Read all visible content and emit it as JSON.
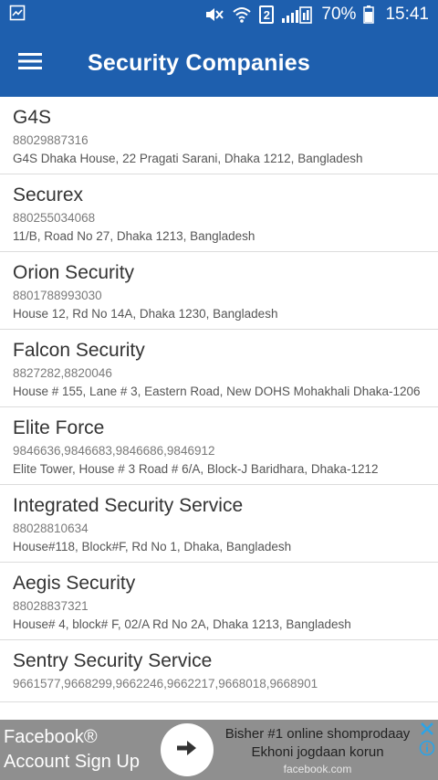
{
  "status_bar": {
    "battery_percent": "70%",
    "time": "15:41",
    "sim_label": "2"
  },
  "app_bar": {
    "title": "Security Companies"
  },
  "companies": [
    {
      "name": "G4S",
      "phone": "88029887316",
      "address": "G4S Dhaka House, 22 Pragati Sarani, Dhaka 1212, Bangladesh"
    },
    {
      "name": "Securex",
      "phone": "880255034068",
      "address": "11/B, Road No 27, Dhaka 1213, Bangladesh"
    },
    {
      "name": "Orion Security",
      "phone": "8801788993030",
      "address": "House 12, Rd No 14A, Dhaka 1230, Bangladesh"
    },
    {
      "name": "Falcon Security",
      "phone": "8827282,8820046",
      "address": "House # 155, Lane # 3, Eastern Road, New DOHS Mohakhali Dhaka-1206"
    },
    {
      "name": "Elite Force",
      "phone": "9846636,9846683,9846686,9846912",
      "address": "Elite Tower, House # 3 Road # 6/A, Block-J Baridhara, Dhaka-1212"
    },
    {
      "name": "Integrated Security Service",
      "phone": "88028810634",
      "address": "House#118, Block#F, Rd No 1, Dhaka, Bangladesh"
    },
    {
      "name": "Aegis Security",
      "phone": "88028837321",
      "address": "House# 4, block# F, 02/A Rd No 2A, Dhaka 1213, Bangladesh"
    },
    {
      "name": "Sentry Security Service",
      "phone": "9661577,9668299,9662246,9662217,9668018,9668901",
      "address": ""
    }
  ],
  "ad": {
    "left_line1": "Facebook®",
    "left_line2": "Account Sign Up",
    "right_line1": "Bisher #1 online shomprodaay",
    "right_line2": "Ekhoni jogdaan korun",
    "domain": "facebook.com"
  }
}
